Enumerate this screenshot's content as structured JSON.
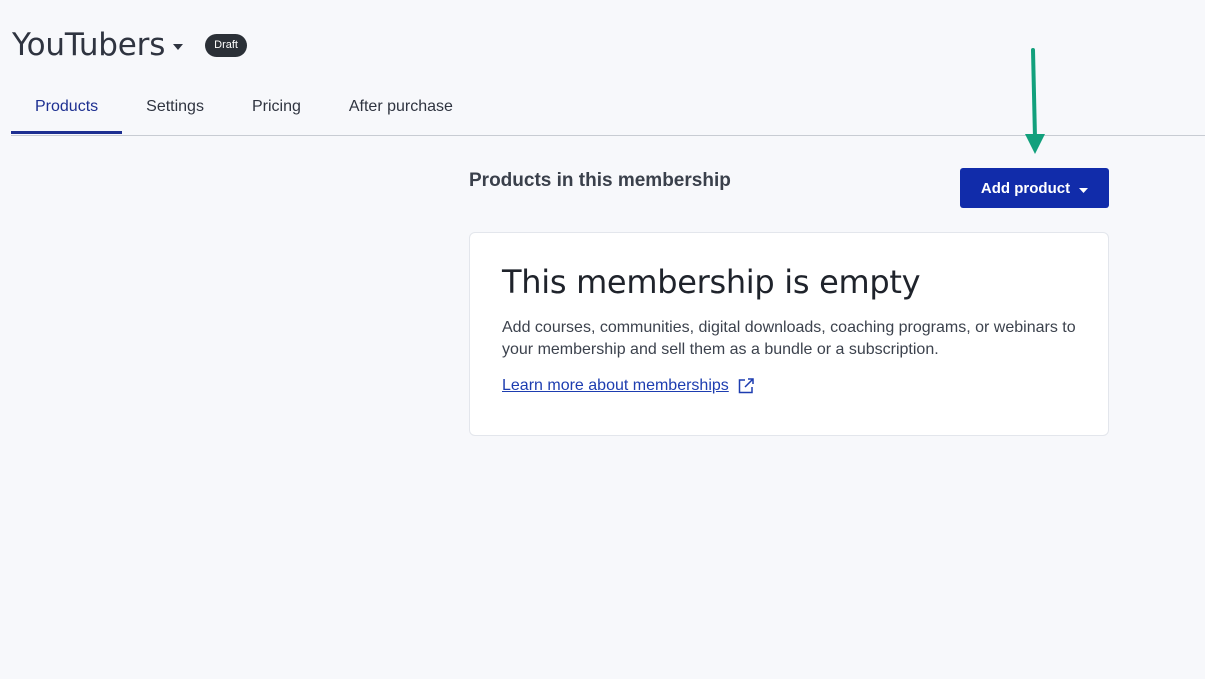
{
  "header": {
    "title": "YouTubers",
    "status_badge": "Draft"
  },
  "tabs": [
    {
      "label": "Products",
      "active": true
    },
    {
      "label": "Settings",
      "active": false
    },
    {
      "label": "Pricing",
      "active": false
    },
    {
      "label": "After purchase",
      "active": false
    }
  ],
  "section": {
    "title": "Products in this membership",
    "add_button_label": "Add product"
  },
  "empty_state": {
    "heading": "This membership is empty",
    "description": "Add courses, communities, digital downloads, coaching programs, or webinars to your membership and sell them as a bundle or a subscription.",
    "link_label": "Learn more about memberships"
  },
  "icons": {
    "title_caret": "caret-down-icon",
    "button_caret": "caret-down-icon",
    "link_icon": "external-link-icon",
    "annotation": "arrow-down-icon"
  },
  "colors": {
    "accent": "#112caa",
    "active_tab": "#1d2f91",
    "badge_bg": "#2b3037",
    "link": "#1d3db0",
    "annotation_arrow": "#12a07c",
    "page_bg": "#f7f8fb"
  }
}
